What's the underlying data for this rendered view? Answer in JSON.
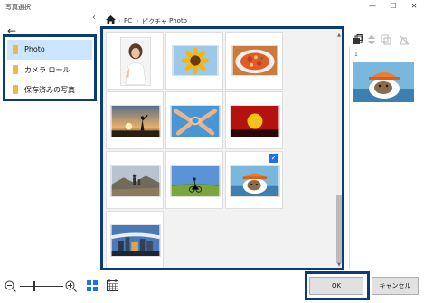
{
  "window": {
    "title": "写真選択",
    "minimize_glyph": "—",
    "maximize_glyph": "☐",
    "close_glyph": "✕"
  },
  "navigation": {
    "back_glyph": "←",
    "collapse_glyph": "‹"
  },
  "sidebar": {
    "items": [
      {
        "label": "Photo",
        "selected": true
      },
      {
        "label": "カメラ ロール",
        "selected": false
      },
      {
        "label": "保存済みの写真",
        "selected": false
      }
    ]
  },
  "breadcrumb": {
    "separator": "›",
    "items": [
      "PC",
      "ピクチャ",
      "Photo"
    ]
  },
  "grid": {
    "check_glyph": "✓",
    "photos": [
      {
        "name": "woman-portrait",
        "selected": false
      },
      {
        "name": "sunflower",
        "selected": false
      },
      {
        "name": "pasta-dish",
        "selected": false
      },
      {
        "name": "silhouette-sunset",
        "selected": false
      },
      {
        "name": "hands-heart",
        "selected": false
      },
      {
        "name": "red-sunset",
        "selected": false
      },
      {
        "name": "hikers-mountain",
        "selected": false
      },
      {
        "name": "cyclist-field",
        "selected": false
      },
      {
        "name": "dog-in-hat",
        "selected": true
      },
      {
        "name": "city-skyline",
        "selected": false
      }
    ]
  },
  "selection_panel": {
    "count": "1"
  },
  "footer": {
    "zoom_level": 0.3,
    "ok_label": "OK",
    "cancel_label": "キャンセル"
  },
  "colors": {
    "highlight_border": "#0d3b77",
    "selected_item_bg": "#cce6ff",
    "accent": "#1a73e8",
    "folder": "#e9b949"
  }
}
